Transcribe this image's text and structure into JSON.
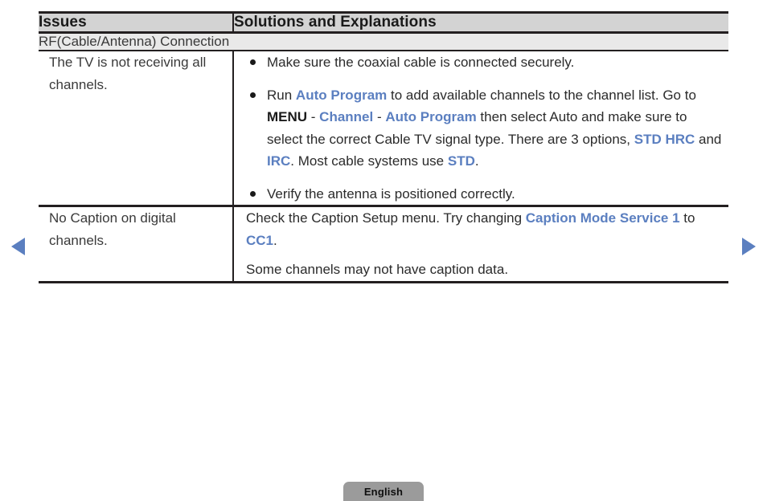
{
  "nav": {
    "prev_icon": "triangle-left-icon",
    "next_icon": "triangle-right-icon",
    "accent_color": "#5b7fc0"
  },
  "table": {
    "headers": {
      "issues": "Issues",
      "solutions": "Solutions and Explanations"
    },
    "section_label": "RF(Cable/Antenna) Connection",
    "rows": [
      {
        "issue": "The TV is not receiving all channels.",
        "bullets": [
          {
            "segments": [
              {
                "text": "Make sure the coaxial cable is connected securely.",
                "style": "normal"
              }
            ]
          },
          {
            "segments": [
              {
                "text": "Run ",
                "style": "normal"
              },
              {
                "text": "Auto Program",
                "style": "accent"
              },
              {
                "text": " to add available channels to the channel list. Go to ",
                "style": "normal"
              },
              {
                "text": "MENU",
                "style": "strong"
              },
              {
                "text": " - ",
                "style": "normal"
              },
              {
                "text": "Channel",
                "style": "accent"
              },
              {
                "text": " - ",
                "style": "normal"
              },
              {
                "text": "Auto Program",
                "style": "accent"
              },
              {
                "text": " then select Auto and make sure to select the correct Cable TV signal type. There are 3 options, ",
                "style": "normal"
              },
              {
                "text": "STD  HRC",
                "style": "accent"
              },
              {
                "text": " and ",
                "style": "normal"
              },
              {
                "text": "IRC",
                "style": "accent"
              },
              {
                "text": ". Most cable systems use ",
                "style": "normal"
              },
              {
                "text": "STD",
                "style": "accent"
              },
              {
                "text": ".",
                "style": "normal"
              }
            ]
          },
          {
            "segments": [
              {
                "text": "Verify the antenna is positioned correctly.",
                "style": "normal"
              }
            ]
          }
        ]
      },
      {
        "issue": "No Caption on digital channels.",
        "paragraphs": [
          {
            "segments": [
              {
                "text": "Check the Caption Setup menu. Try changing ",
                "style": "normal"
              },
              {
                "text": "Caption Mode Service 1",
                "style": "accent"
              },
              {
                "text": " to ",
                "style": "normal"
              },
              {
                "text": "CC1",
                "style": "accent"
              },
              {
                "text": ".",
                "style": "normal"
              }
            ]
          },
          {
            "segments": [
              {
                "text": "Some channels may not have caption data.",
                "style": "normal"
              }
            ]
          }
        ]
      }
    ]
  },
  "footer": {
    "language": "English"
  }
}
